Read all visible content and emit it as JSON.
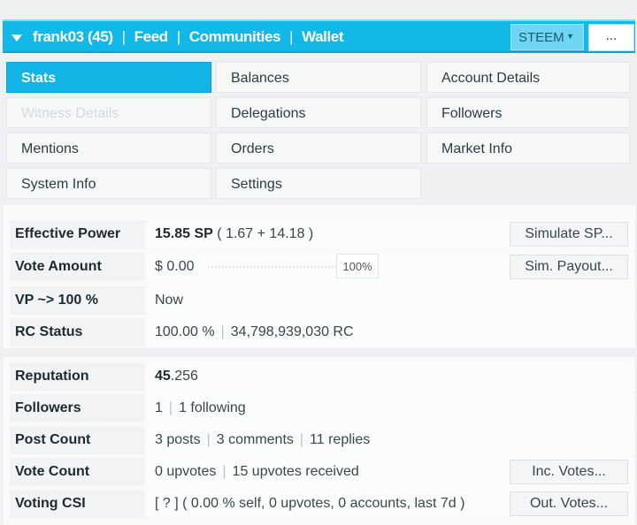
{
  "header": {
    "account": "frank03 (45)",
    "links": [
      "Feed",
      "Communities",
      "Wallet"
    ],
    "separator": "|",
    "chain_select": "STEEM",
    "more_label": "...",
    "colors": {
      "bar": "#12b8e8",
      "active_tab": "#12b4e6"
    }
  },
  "tabs": [
    {
      "label": "Stats",
      "state": "active"
    },
    {
      "label": "Balances",
      "state": "normal"
    },
    {
      "label": "Account Details",
      "state": "normal"
    },
    {
      "label": "Witness Details",
      "state": "disabled"
    },
    {
      "label": "Delegations",
      "state": "normal"
    },
    {
      "label": "Followers",
      "state": "normal"
    },
    {
      "label": "Mentions",
      "state": "normal"
    },
    {
      "label": "Orders",
      "state": "normal"
    },
    {
      "label": "Market Info",
      "state": "normal"
    },
    {
      "label": "System Info",
      "state": "normal"
    },
    {
      "label": "Settings",
      "state": "normal"
    }
  ],
  "stats": {
    "effective_power": {
      "label": "Effective Power",
      "value": "15.85 SP",
      "detail": "( 1.67 + 14.18 )",
      "button": "Simulate SP..."
    },
    "vote_amount": {
      "label": "Vote Amount",
      "value": "$ 0.00",
      "weight": "100%",
      "button": "Sim. Payout..."
    },
    "vp": {
      "label": "VP ~> 100 %",
      "value": "Now"
    },
    "rc": {
      "label": "RC Status",
      "percent": "100.00 %",
      "amount": "34,798,939,030 RC"
    },
    "reputation": {
      "label": "Reputation",
      "int": "45",
      "dec": ".256"
    },
    "followers": {
      "label": "Followers",
      "count": "1",
      "following": "1 following"
    },
    "post_count": {
      "label": "Post Count",
      "posts": "3 posts",
      "comments": "3 comments",
      "replies": "11 replies"
    },
    "vote_count": {
      "label": "Vote Count",
      "upvotes": "0 upvotes",
      "received": "15 upvotes received",
      "button": "Inc. Votes..."
    },
    "voting_csi": {
      "label": "Voting CSI",
      "value": "[ ? ] ( 0.00 % self, 0 upvotes, 0 accounts, last 7d )",
      "button": "Out. Votes..."
    }
  }
}
